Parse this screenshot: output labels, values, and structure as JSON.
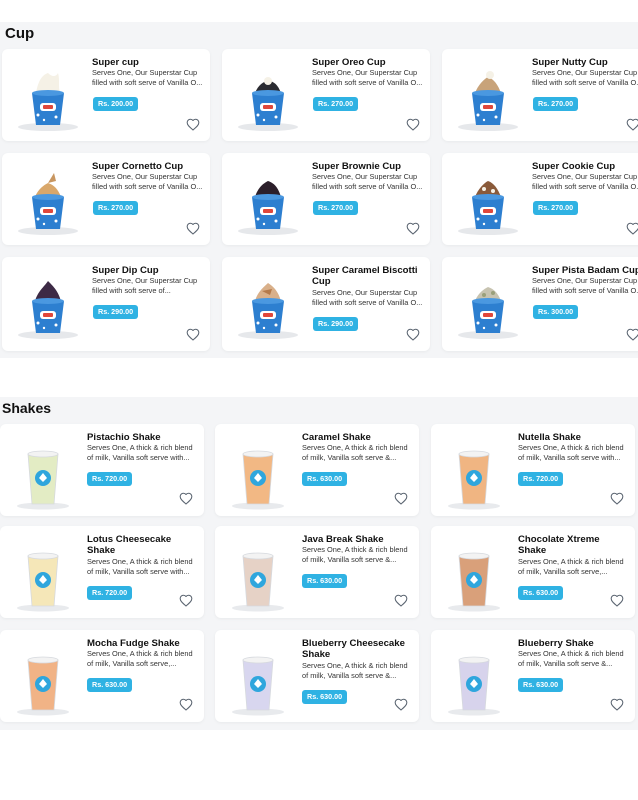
{
  "colors": {
    "accent": "#2fb2e3",
    "section_bg": "#f4f5f7",
    "card_bg": "#ffffff",
    "cup_blue": "#2d7fd0"
  },
  "sections": {
    "cup": {
      "title": "Cup",
      "items": [
        {
          "name": "Super cup",
          "desc": "Serves One, Our Superstar Cup filled with soft serve of Vanilla O...",
          "price": "Rs. 200.00",
          "topping": "plain"
        },
        {
          "name": "Super Oreo Cup",
          "desc": "Serves One, Our Superstar Cup filled with soft serve of Vanilla O...",
          "price": "Rs. 270.00",
          "topping": "oreo"
        },
        {
          "name": "Super Nutty Cup",
          "desc": "Serves One, Our Superstar Cup filled with soft serve of Vanilla O...",
          "price": "Rs. 270.00",
          "topping": "nutty"
        },
        {
          "name": "Super Cornetto Cup",
          "desc": "Serves One, Our Superstar Cup filled with soft serve of Vanilla O...",
          "price": "Rs. 270.00",
          "topping": "cornetto"
        },
        {
          "name": "Super Brownie Cup",
          "desc": "Serves One, Our Superstar Cup filled with soft serve of Vanilla O...",
          "price": "Rs. 270.00",
          "topping": "brownie"
        },
        {
          "name": "Super Cookie Cup",
          "desc": "Serves One, Our Superstar Cup filled with soft serve of Vanilla O...",
          "price": "Rs. 270.00",
          "topping": "cookie"
        },
        {
          "name": "Super Dip Cup",
          "desc": "Serves One, Our Superstar Cup filled with soft serve of...",
          "price": "Rs. 290.00",
          "topping": "dip"
        },
        {
          "name": "Super Caramel Biscotti Cup",
          "desc": "Serves One, Our Superstar Cup filled with soft serve of Vanilla O...",
          "price": "Rs. 290.00",
          "topping": "caramel"
        },
        {
          "name": "Super Pista Badam Cup",
          "desc": "Serves One, Our Superstar Cup filled with soft serve of Vanilla O...",
          "price": "Rs. 300.00",
          "topping": "pista"
        }
      ]
    },
    "shakes": {
      "title": "Shakes",
      "items": [
        {
          "name": "Pistachio Shake",
          "desc": "Serves One, A thick & rich blend of milk, Vanilla soft serve with...",
          "price": "Rs. 720.00",
          "color": "#e3ecc4"
        },
        {
          "name": "Caramel Shake",
          "desc": "Serves One, A thick & rich blend of milk, Vanilla soft serve &...",
          "price": "Rs. 630.00",
          "color": "#f2b884"
        },
        {
          "name": "Nutella Shake",
          "desc": "Serves One, A thick & rich blend of milk, Vanilla soft serve with...",
          "price": "Rs. 720.00",
          "color": "#f0b582"
        },
        {
          "name": "Lotus Cheesecake Shake",
          "desc": "Serves One, A thick & rich blend of milk, Vanilla soft serve with...",
          "price": "Rs. 720.00",
          "color": "#f5e7b8"
        },
        {
          "name": "Java Break Shake",
          "desc": "Serves One, A thick & rich blend of milk, Vanilla soft serve &...",
          "price": "Rs. 630.00",
          "color": "#e6d2c6"
        },
        {
          "name": "Chocolate Xtreme Shake",
          "desc": "Serves One, A thick & rich blend of milk, Vanilla soft serve,...",
          "price": "Rs. 630.00",
          "color": "#d9a07a"
        },
        {
          "name": "Mocha Fudge Shake",
          "desc": "Serves One, A thick & rich blend of milk, Vanilla soft serve,...",
          "price": "Rs. 630.00",
          "color": "#f1b386"
        },
        {
          "name": "Blueberry Cheesecake Shake",
          "desc": "Serves One, A thick & rich blend of milk, Vanilla soft serve &...",
          "price": "Rs. 630.00",
          "color": "#d8d6ef"
        },
        {
          "name": "Blueberry Shake",
          "desc": "Serves One, A thick & rich blend of milk, Vanilla soft serve &...",
          "price": "Rs. 630.00",
          "color": "#d7d3ec"
        }
      ]
    }
  }
}
